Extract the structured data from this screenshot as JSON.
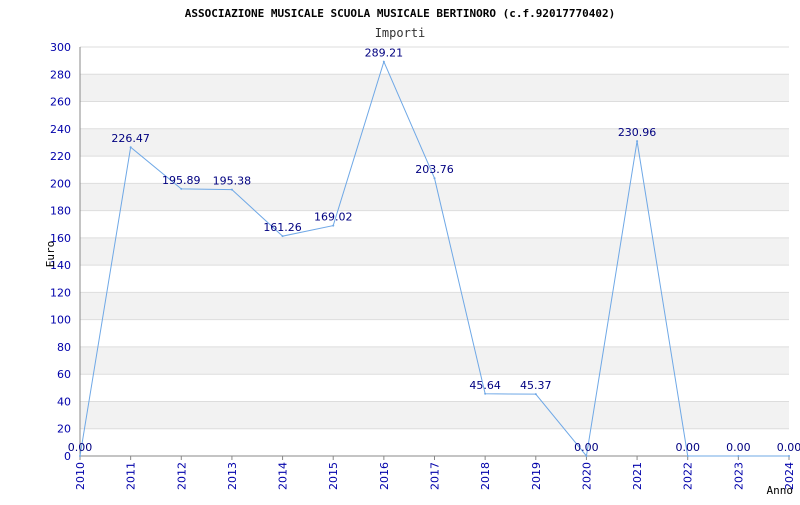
{
  "chart_data": {
    "type": "line",
    "title": "ASSOCIAZIONE MUSICALE SCUOLA MUSICALE BERTINORO (c.f.92017770402)",
    "subtitle": "Importi",
    "xlabel": "Anno",
    "ylabel": "Euro",
    "categories": [
      "2010",
      "2011",
      "2012",
      "2013",
      "2014",
      "2015",
      "2016",
      "2017",
      "2018",
      "2019",
      "2020",
      "2021",
      "2022",
      "2023",
      "2024"
    ],
    "values": [
      0.0,
      226.47,
      195.89,
      195.38,
      161.26,
      169.02,
      289.21,
      203.76,
      45.64,
      45.37,
      0.0,
      230.96,
      0.0,
      0.0,
      0.0
    ],
    "value_labels": [
      "0.00",
      "226.47",
      "195.89",
      "195.38",
      "161.26",
      "169.02",
      "289.21",
      "203.76",
      "45.64",
      "45.37",
      "0.00",
      "230.96",
      "0.00",
      "0.00",
      "0.00"
    ],
    "y_ticks": [
      "0",
      "20",
      "40",
      "60",
      "80",
      "100",
      "120",
      "140",
      "160",
      "180",
      "200",
      "220",
      "240",
      "260",
      "280",
      "300"
    ],
    "ylim": [
      0,
      300
    ],
    "grid": true,
    "colors": {
      "line": "#6fa8e6",
      "tick_text": "#0000aa",
      "label_text": "#000080",
      "band": "#f2f2f2",
      "grid": "#dddddd",
      "axis": "#888888"
    }
  }
}
